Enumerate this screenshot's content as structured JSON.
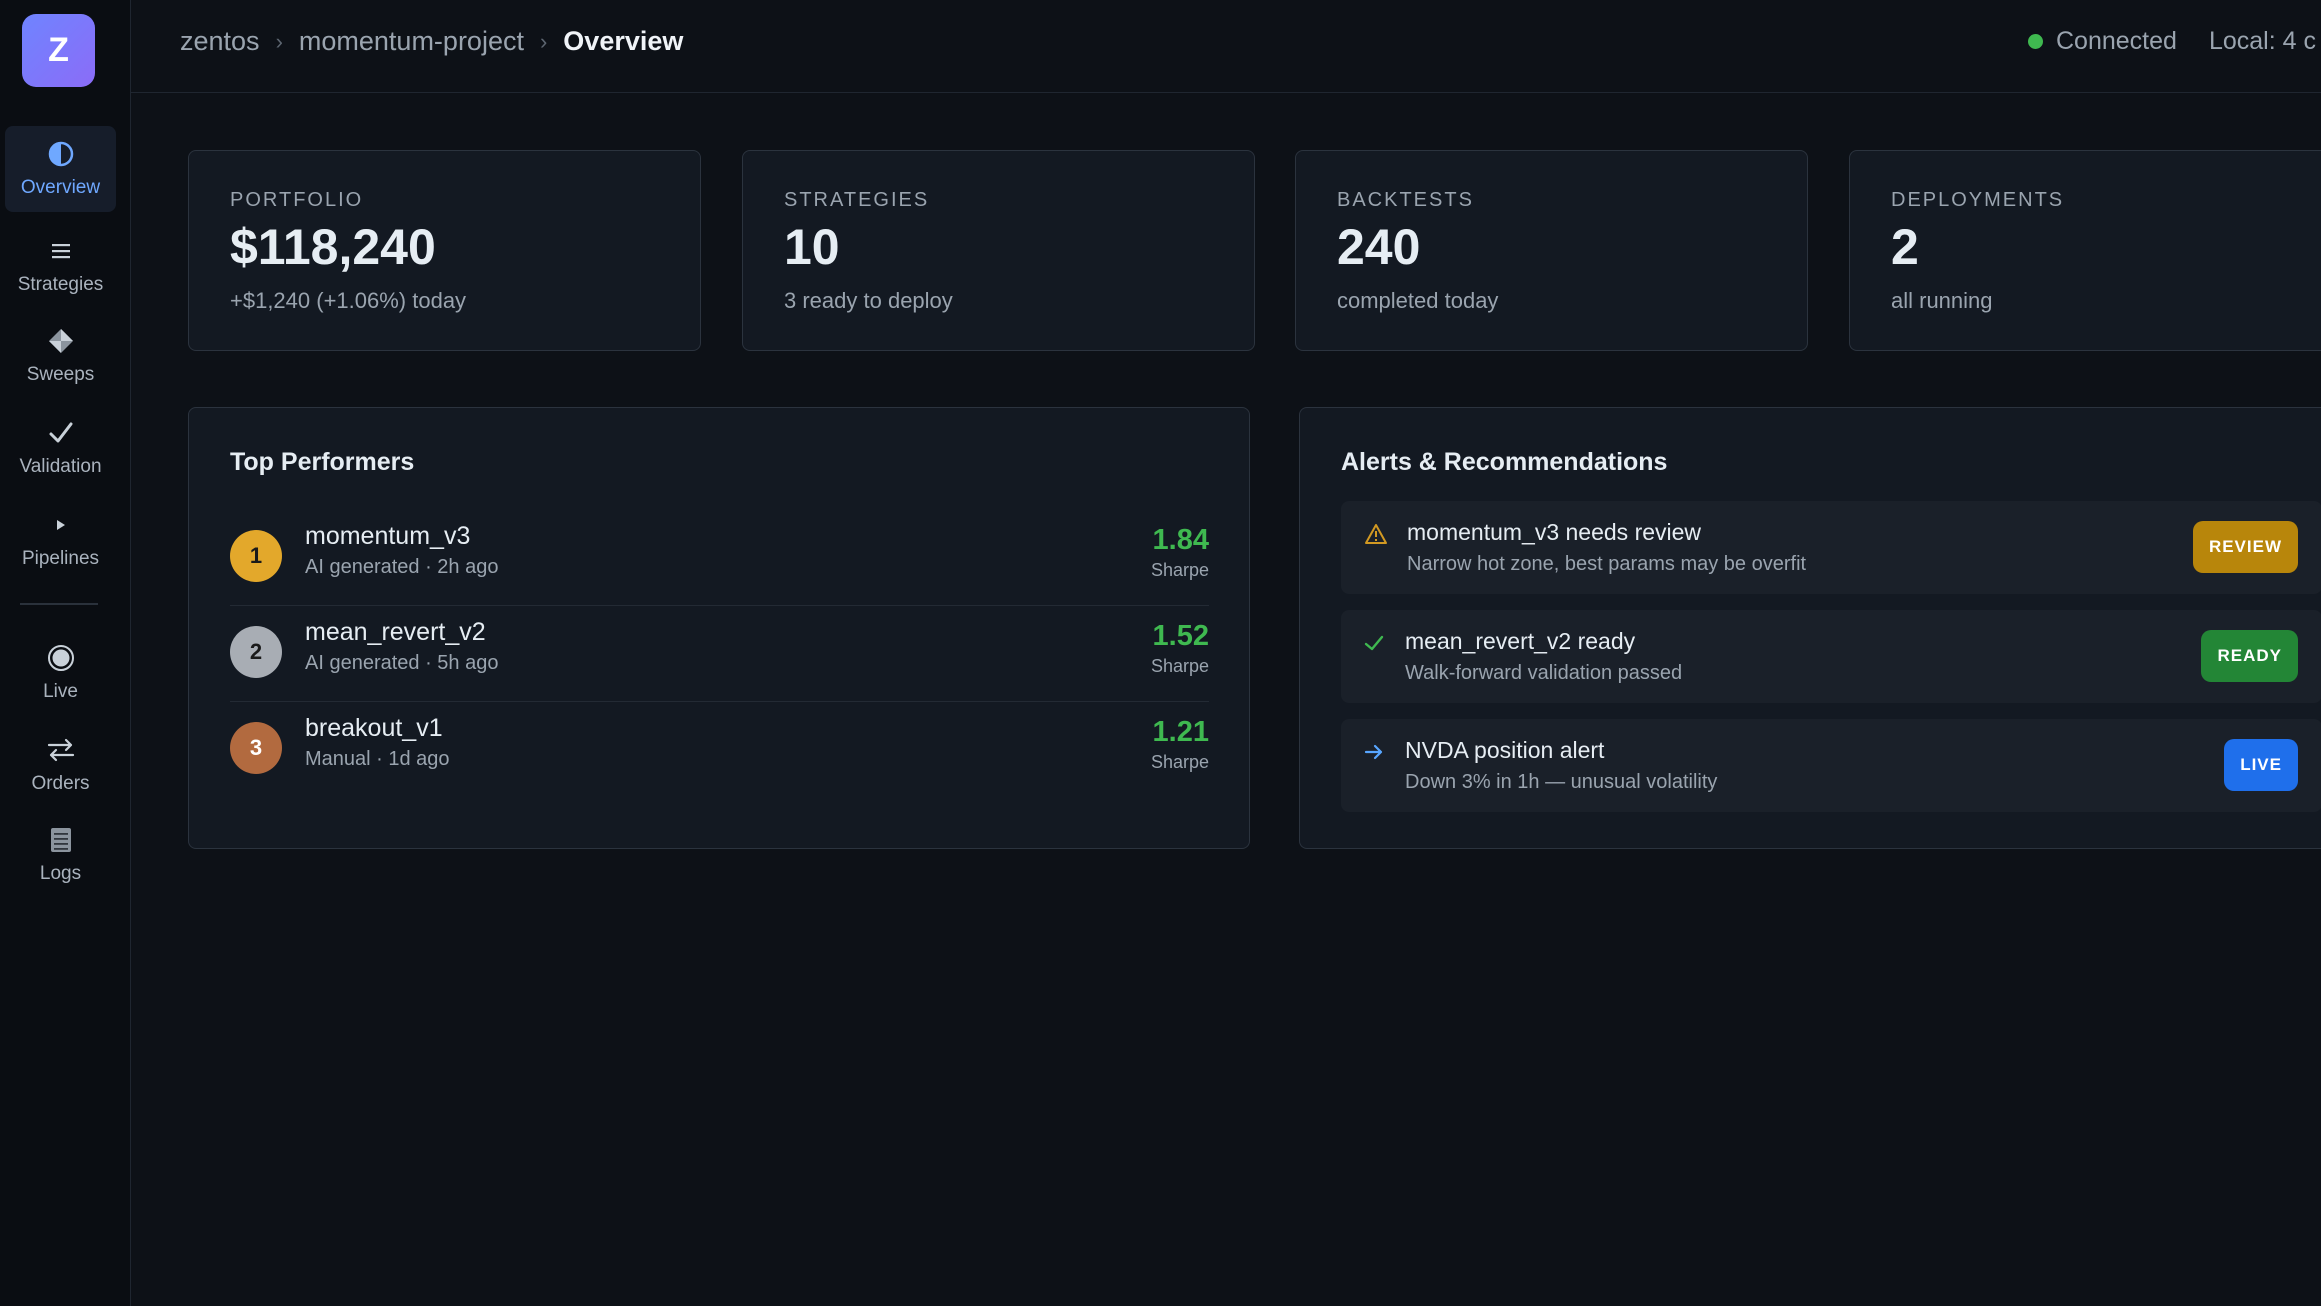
{
  "app": {
    "logo_letter": "Z"
  },
  "sidebar": {
    "items": [
      {
        "label": "Overview",
        "icon": "half-circle-icon",
        "active": true
      },
      {
        "label": "Strategies",
        "icon": "hamburger-list-icon"
      },
      {
        "label": "Sweeps",
        "icon": "diamond-icon"
      },
      {
        "label": "Validation",
        "icon": "checkmark-icon"
      },
      {
        "label": "Pipelines",
        "icon": "play-triangle-icon"
      },
      {
        "label": "Live",
        "icon": "radio-target-icon"
      },
      {
        "label": "Orders",
        "icon": "swap-arrows-icon"
      },
      {
        "label": "Logs",
        "icon": "document-lines-icon"
      }
    ]
  },
  "header": {
    "breadcrumb": [
      "zentos",
      "momentum-project",
      "Overview"
    ],
    "status": "Connected",
    "status_color": "#3fb950",
    "local": "Local: 4 c"
  },
  "stats": [
    {
      "label": "PORTFOLIO",
      "value": "$118,240",
      "sub": "+$1,240 (+1.06%) today"
    },
    {
      "label": "STRATEGIES",
      "value": "10",
      "sub": "3 ready to deploy"
    },
    {
      "label": "BACKTESTS",
      "value": "240",
      "sub": "completed today"
    },
    {
      "label": "DEPLOYMENTS",
      "value": "2",
      "sub": "all running"
    }
  ],
  "top_performers": {
    "title": "Top Performers",
    "rows": [
      {
        "rank": "1",
        "name": "momentum_v3",
        "meta": "AI generated · 2h ago",
        "score": "1.84",
        "score_label": "Sharpe",
        "rank_color": "#e3a82b"
      },
      {
        "rank": "2",
        "name": "mean_revert_v2",
        "meta": "AI generated · 5h ago",
        "score": "1.52",
        "score_label": "Sharpe",
        "rank_color": "#a8adb4"
      },
      {
        "rank": "3",
        "name": "breakout_v1",
        "meta": "Manual · 1d ago",
        "score": "1.21",
        "score_label": "Sharpe",
        "rank_color": "#b26a3f"
      }
    ]
  },
  "alerts": {
    "title": "Alerts & Recommendations",
    "rows": [
      {
        "icon": "warning-triangle-icon",
        "title": "momentum_v3 needs review",
        "desc": "Narrow hot zone, best params may be overfit",
        "badge": "REVIEW",
        "badge_color": "#b8860b"
      },
      {
        "icon": "checkmark-icon",
        "title": "mean_revert_v2 ready",
        "desc": "Walk-forward validation passed",
        "badge": "READY",
        "badge_color": "#238636"
      },
      {
        "icon": "arrow-right-icon",
        "title": "NVDA position alert",
        "desc": "Down 3% in 1h — unusual volatility",
        "badge": "LIVE",
        "badge_color": "#1f6feb"
      }
    ]
  }
}
